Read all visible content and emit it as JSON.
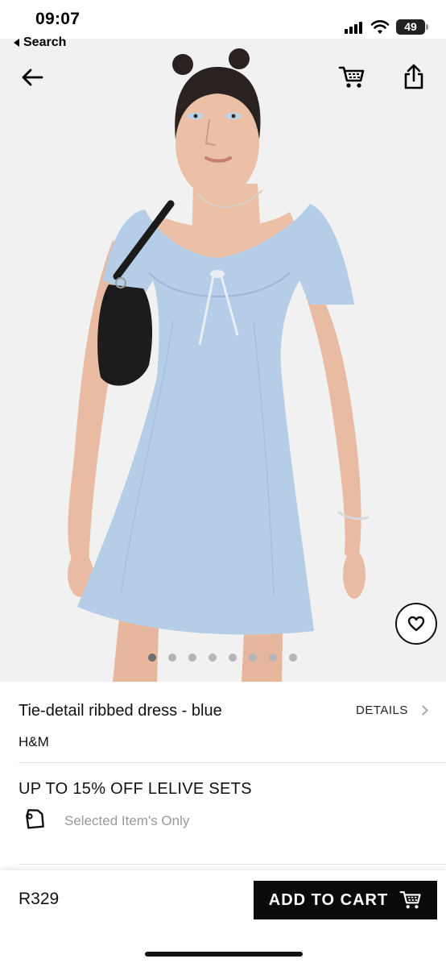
{
  "status_bar": {
    "time": "09:07",
    "back_app_label": "Search",
    "battery": "49"
  },
  "hero": {
    "image_description_icon": "product-photo",
    "carousel": {
      "total": 8,
      "active_index": 0
    },
    "icons": {
      "back": "back-arrow-icon",
      "cart": "cart-icon",
      "share": "share-icon",
      "favorite": "heart-icon"
    }
  },
  "product": {
    "title": "Tie-detail ribbed dress - blue",
    "details_label": "DETAILS",
    "brand": "H&M"
  },
  "promo": {
    "title": "UP TO 15% OFF LELIVE SETS",
    "subtitle": "Selected Item's Only"
  },
  "footer": {
    "price": "R329",
    "add_to_cart_label": "ADD TO CART"
  },
  "colors": {
    "accent": "#0a0a0a",
    "dress_blue": "#b5cde6",
    "background": "#f1f1f1"
  }
}
